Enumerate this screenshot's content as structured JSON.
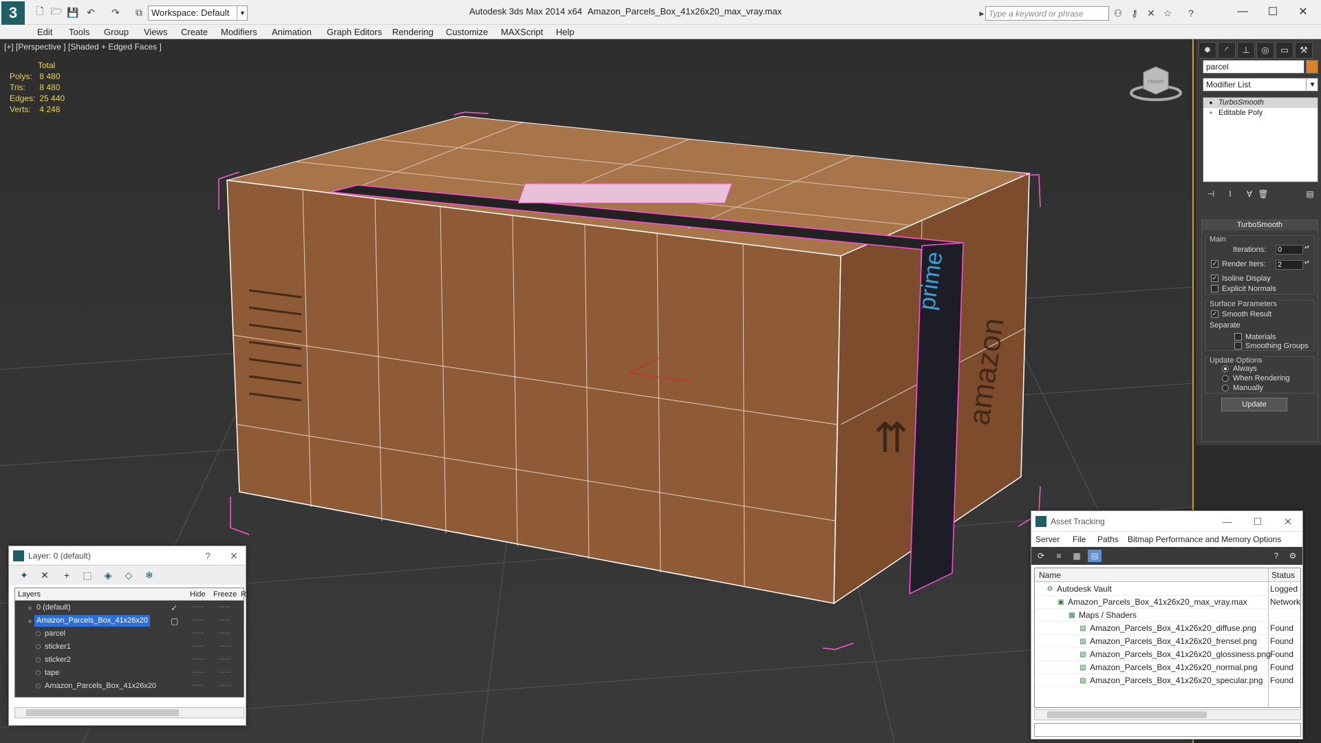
{
  "titlebar": {
    "app_title": "Autodesk 3ds Max  2014 x64",
    "file_title": "Amazon_Parcels_Box_41x26x20_max_vray.max",
    "workspace": "Workspace: Default",
    "search_placeholder": "Type a keyword or phrase"
  },
  "menu": [
    "Edit",
    "Tools",
    "Group",
    "Views",
    "Create",
    "Modifiers",
    "Animation",
    "Graph Editors",
    "Rendering",
    "Customize",
    "MAXScript",
    "Help"
  ],
  "viewport": {
    "label": "[+] [Perspective ] [Shaded + Edged Faces ]",
    "stats": {
      "header": "Total",
      "rows": [
        {
          "label": "Polys:",
          "value": "8 480"
        },
        {
          "label": "Tris:",
          "value": "8 480"
        },
        {
          "label": "Edges:",
          "value": "25 440"
        },
        {
          "label": "Verts:",
          "value": "4 248"
        }
      ]
    },
    "viewcube_label": "FRONT"
  },
  "command_panel": {
    "object_name": "parcel",
    "object_color": "#d9822b",
    "modifier_list": "Modifier List",
    "stack": [
      "TurboSmooth",
      "Editable Poly"
    ],
    "rollout": {
      "title": "TurboSmooth",
      "main_label": "Main",
      "iterations_label": "Iterations:",
      "iterations_value": "0",
      "render_iters_label": "Render Iters:",
      "render_iters_value": "2",
      "isoline_label": "Isoline Display",
      "explicit_label": "Explicit Normals",
      "surface_label": "Surface Parameters",
      "smooth_label": "Smooth Result",
      "separate_label": "Separate",
      "materials_label": "Materials",
      "smoothing_label": "Smoothing Groups",
      "update_options_label": "Update Options",
      "always_label": "Always",
      "when_rendering_label": "When Rendering",
      "manually_label": "Manually",
      "update_button": "Update"
    }
  },
  "layer_panel": {
    "title": "Layer: 0 (default)",
    "help": "?",
    "close": "✕",
    "headers": {
      "layers": "Layers",
      "hide": "Hide",
      "freeze": "Freeze",
      "render": "R"
    },
    "rows": [
      {
        "name": "0 (default)",
        "indent": 0
      },
      {
        "name": "Amazon_Parcels_Box_41x26x20",
        "indent": 0
      },
      {
        "name": "parcel",
        "indent": 1
      },
      {
        "name": "sticker1",
        "indent": 1
      },
      {
        "name": "sticker2",
        "indent": 1
      },
      {
        "name": "tape",
        "indent": 1
      },
      {
        "name": "Amazon_Parcels_Box_41x26x20",
        "indent": 1
      }
    ]
  },
  "asset_panel": {
    "title": "Asset Tracking",
    "menu": [
      "Server",
      "File",
      "Paths",
      "Bitmap Performance and Memory",
      "Options"
    ],
    "headers": {
      "name": "Name",
      "status": "Status"
    },
    "rows": [
      {
        "name": "Autodesk Vault",
        "status": "Logged Out",
        "indent": 1
      },
      {
        "name": "Amazon_Parcels_Box_41x26x20_max_vray.max",
        "status": "Network",
        "indent": 2
      },
      {
        "name": "Maps / Shaders",
        "status": "",
        "indent": 3
      },
      {
        "name": "Amazon_Parcels_Box_41x26x20_diffuse.png",
        "status": "Found",
        "indent": 4
      },
      {
        "name": "Amazon_Parcels_Box_41x26x20_frensel.png",
        "status": "Found",
        "indent": 4
      },
      {
        "name": "Amazon_Parcels_Box_41x26x20_glossiness.png",
        "status": "Found",
        "indent": 4
      },
      {
        "name": "Amazon_Parcels_Box_41x26x20_normal.png",
        "status": "Found",
        "indent": 4
      },
      {
        "name": "Amazon_Parcels_Box_41x26x20_specular.png",
        "status": "Found",
        "indent": 4
      }
    ]
  },
  "scene": {
    "box_label_side": "amazon",
    "tape_text": "prime"
  }
}
